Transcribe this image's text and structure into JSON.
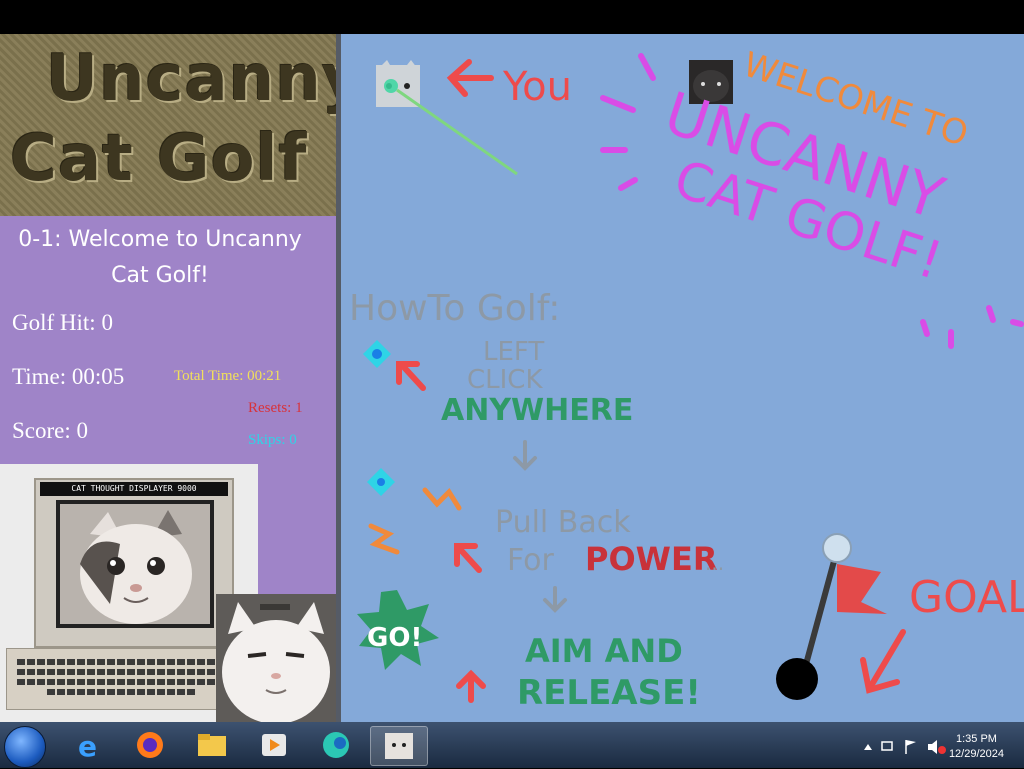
{
  "game": {
    "logo_line1": "Uncanny",
    "logo_line2": "Cat Golf",
    "level_title": "0-1: Welcome to Uncanny Cat Golf!",
    "golf_hit": "Golf Hit: 0",
    "time": "Time: 00:05",
    "total_time": "Total Time: 00:21",
    "resets": "Resets: 1",
    "score": "Score: 0",
    "skips": "Skips: 0",
    "monitor_label": "CAT THOUGHT DISPLAYER 9000"
  },
  "field": {
    "you_label": "You",
    "welcome_to": "WELCOME TO",
    "uncanny": "UNCANNY",
    "cat_golf": "CAT GOLF!",
    "how_to": "HowTo Golf:",
    "left": "LEFT",
    "click": "CLICK",
    "anywhere": "ANYWHERE",
    "pull_back": "Pull Back",
    "for": "For",
    "power": "POWER",
    "ellipsis": "...",
    "go": "GO!",
    "aim_and": "AIM AND",
    "release": "RELEASE!",
    "goal": "GOAL"
  },
  "colors": {
    "sidebar": "#9f84c8",
    "field": "#84a9d9",
    "total_time": "#f1e05a",
    "resets": "#d8323a",
    "skips": "#2fd4e6",
    "orange_arrow": "#ee4b4b",
    "magenta": "#d94ce6",
    "orange": "#f08a3c",
    "gray_text": "#8d99a6",
    "green_text": "#2f9a66",
    "red_text": "#c8323a"
  },
  "taskbar": {
    "time": "1:35 PM",
    "date": "12/29/2024"
  },
  "icons": [
    "windows-start-icon",
    "internet-explorer-icon",
    "firefox-icon",
    "file-explorer-icon",
    "media-player-icon",
    "edge-icon",
    "cat-game-icon",
    "tray-arrow-icon",
    "network-icon",
    "flag-icon",
    "volume-muted-icon"
  ]
}
